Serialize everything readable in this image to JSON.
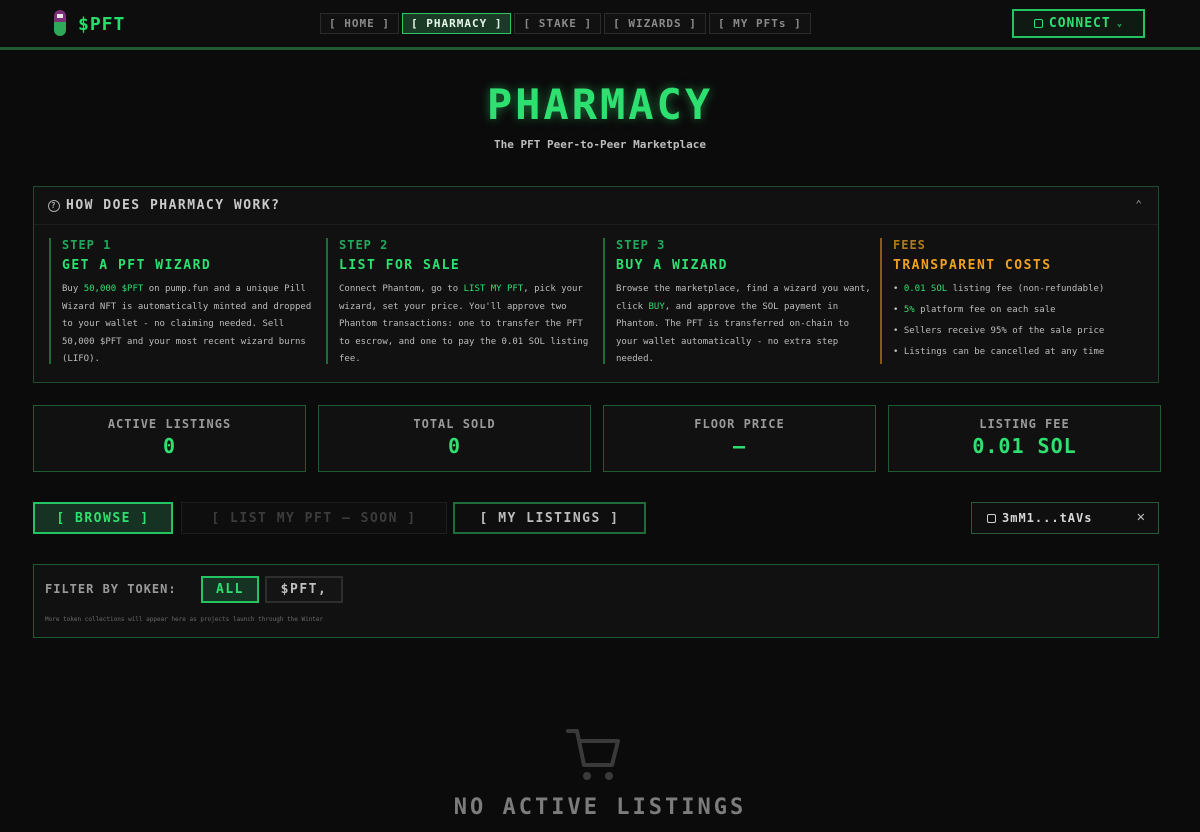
{
  "header": {
    "brand": "$PFT",
    "nav": [
      {
        "label": "[ HOME ]",
        "active": false
      },
      {
        "label": "[ PHARMACY ]",
        "active": true
      },
      {
        "label": "[ STAKE ]",
        "active": false
      },
      {
        "label": "[ WIZARDS ]",
        "active": false
      },
      {
        "label": "[ MY PFTs ]",
        "active": false
      }
    ],
    "connect_label": "CONNECT"
  },
  "hero": {
    "title": "PHARMACY",
    "subtitle": "The PFT Peer-to-Peer Marketplace"
  },
  "how": {
    "heading": "HOW DOES PHARMACY WORK?",
    "steps": [
      {
        "num": "STEP 1",
        "title": "GET A PFT WIZARD",
        "body_parts": [
          "Buy ",
          "50,000 $PFT",
          " on pump.fun and a unique Pill Wizard NFT is automatically minted and dropped to your wallet - no claiming needed. Sell 50,000 $PFT and your most recent wizard burns (LIFO)."
        ]
      },
      {
        "num": "STEP 2",
        "title": "LIST FOR SALE",
        "body_parts": [
          "Connect Phantom, go to ",
          "LIST MY PFT",
          ", pick your wizard, set your price. You'll approve two Phantom transactions: one to transfer the PFT to escrow, and one to pay the 0.01 SOL listing fee."
        ]
      },
      {
        "num": "STEP 3",
        "title": "BUY A WIZARD",
        "body_parts": [
          "Browse the marketplace, find a wizard you want, click ",
          "BUY",
          ", and approve the SOL payment in Phantom. The PFT is transferred on-chain to your wallet automatically - no extra step needed."
        ]
      }
    ],
    "fees": {
      "num": "FEES",
      "title": "TRANSPARENT COSTS",
      "items": [
        {
          "prefix": "• ",
          "hl": "0.01 SOL",
          "rest": " listing fee (non-refundable)"
        },
        {
          "prefix": "• ",
          "hl": "5%",
          "rest": " platform fee on each sale"
        },
        {
          "prefix": "• ",
          "hl": "",
          "rest": "Sellers receive 95% of the sale price"
        },
        {
          "prefix": "• ",
          "hl": "",
          "rest": "Listings can be cancelled at any time"
        }
      ]
    }
  },
  "stats": [
    {
      "label": "ACTIVE LISTINGS",
      "value": "0"
    },
    {
      "label": "TOTAL SOLD",
      "value": "0"
    },
    {
      "label": "FLOOR PRICE",
      "value": "—"
    },
    {
      "label": "LISTING FEE",
      "value": "0.01 SOL"
    }
  ],
  "tabs": {
    "browse": "[ BROWSE ]",
    "list": "[ LIST MY PFT — SOON ]",
    "mine": "[ MY LISTINGS ]"
  },
  "wallet": {
    "address": "3mM1...tAVs"
  },
  "filter": {
    "label": "FILTER BY TOKEN:",
    "options": [
      "ALL",
      "$PFT,"
    ],
    "note": "More token collections will appear here as projects launch through the Winter"
  },
  "empty": {
    "text": "NO ACTIVE LISTINGS"
  },
  "colors": {
    "accent": "#2ee070",
    "fees": "#f0a020",
    "background": "#0b0b0b"
  }
}
